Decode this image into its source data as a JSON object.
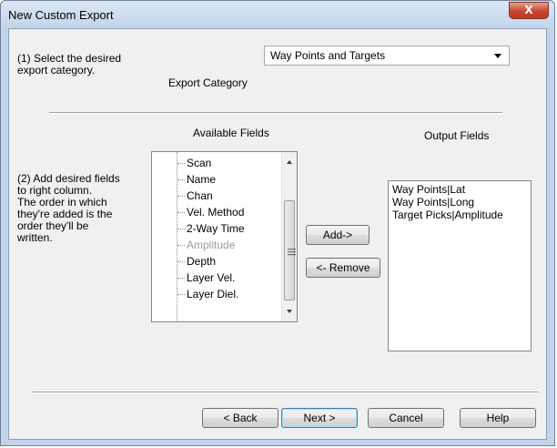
{
  "window": {
    "title": "New Custom Export",
    "close_label": "X"
  },
  "step1": {
    "instruction": "(1) Select the desired\nexport category.",
    "category_label": "Export Category",
    "category_value": "Way Points and Targets"
  },
  "step2": {
    "instruction": "(2) Add desired fields\nto right column.\nThe order in which\nthey're added is the\norder they'll be\nwritten.",
    "available_label": "Available Fields",
    "output_label": "Output Fields",
    "available_fields": [
      "Scan",
      "Name",
      "Chan",
      "Vel. Method",
      "2-Way Time",
      "Amplitude",
      "Depth",
      "Layer Vel.",
      "Layer Diel."
    ],
    "output_fields": [
      "Way Points|Lat",
      "Way Points|Long",
      "Target Picks|Amplitude"
    ],
    "add_label": "Add->",
    "remove_label": "<- Remove"
  },
  "buttons": {
    "back": "< Back",
    "next": "Next >",
    "cancel": "Cancel",
    "help": "Help"
  }
}
